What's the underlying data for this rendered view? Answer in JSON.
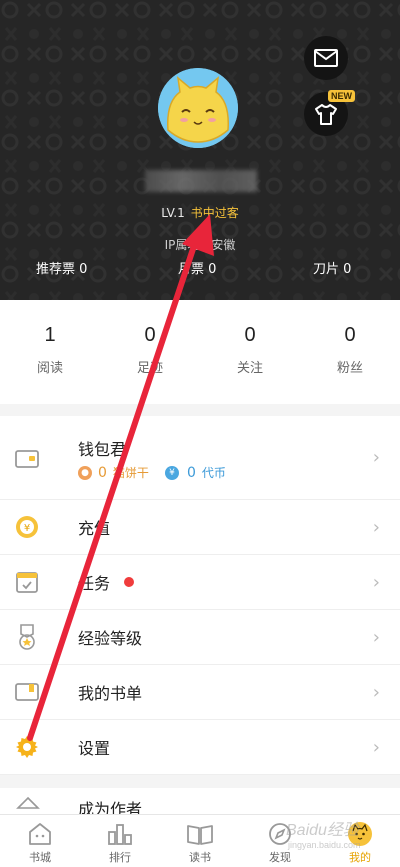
{
  "header": {
    "level": "LV.1",
    "level_title": "书中过客",
    "ip_text": "IP属地：安徽",
    "tickets": [
      {
        "label": "推荐票",
        "value": "0"
      },
      {
        "label": "月票",
        "value": "0"
      },
      {
        "label": "刀片",
        "value": "0"
      }
    ],
    "new_badge": "NEW"
  },
  "stats": [
    {
      "value": "1",
      "label": "阅读"
    },
    {
      "value": "0",
      "label": "足迹"
    },
    {
      "value": "0",
      "label": "关注"
    },
    {
      "value": "0",
      "label": "粉丝"
    }
  ],
  "menu": {
    "wallet": {
      "label": "钱包君",
      "cookie_value": "0",
      "cookie_label": "猫饼干",
      "coin_value": "0",
      "coin_label": "代币"
    },
    "recharge": "充值",
    "tasks": "任务",
    "exp_level": "经验等级",
    "booklist": "我的书单",
    "settings": "设置",
    "become_author": "成为作者"
  },
  "nav": [
    {
      "label": "书城",
      "icon": "bookstore-icon"
    },
    {
      "label": "排行",
      "icon": "ranking-icon"
    },
    {
      "label": "读书",
      "icon": "read-icon"
    },
    {
      "label": "发现",
      "icon": "discover-icon"
    },
    {
      "label": "我的",
      "icon": "profile-icon",
      "active": true
    }
  ],
  "watermark": {
    "text": "Baidu经验",
    "sub": "jingyan.baidu.com"
  },
  "colors": {
    "accent": "#f6c23a",
    "header_bg": "#262626",
    "arrow": "#e8253a"
  }
}
